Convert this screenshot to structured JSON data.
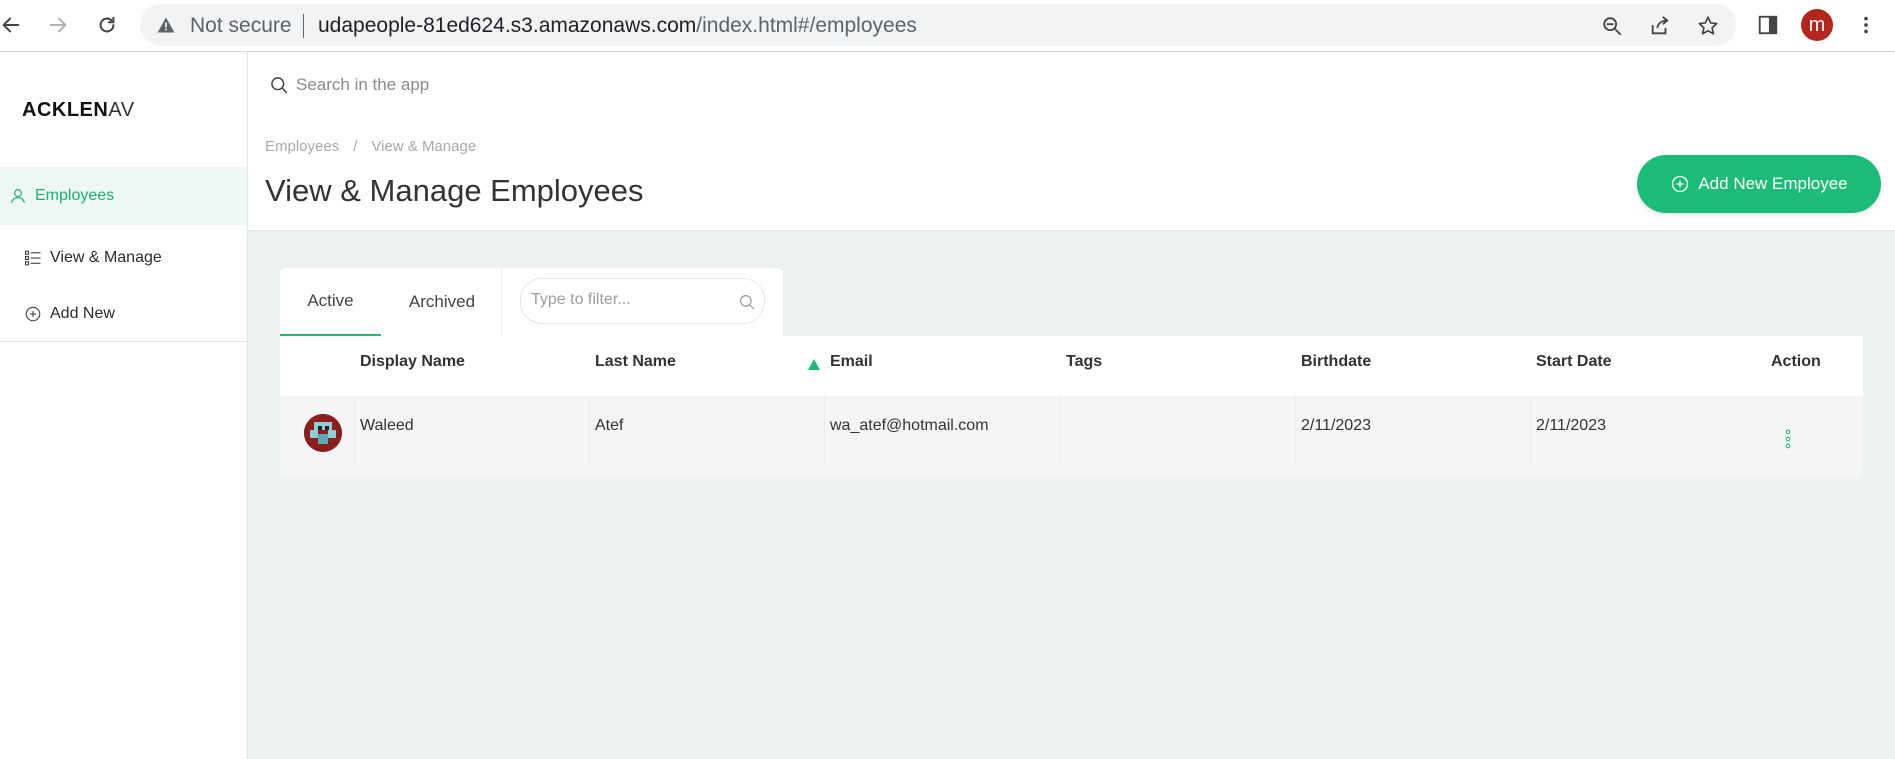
{
  "browser": {
    "security_label": "Not secure",
    "url_host": "udapeople-81ed624.s3.amazonaws.com",
    "url_path": "/index.html#/employees",
    "profile_initial": "m"
  },
  "app": {
    "logo_bold": "ACKLEN",
    "logo_light": "AV",
    "search_placeholder": "Search in the app"
  },
  "sidebar": {
    "items": [
      {
        "label": "Employees",
        "icon": "user-icon",
        "active": true
      },
      {
        "label": "View & Manage",
        "icon": "list-icon",
        "active": false
      },
      {
        "label": "Add New",
        "icon": "plus-circle-icon",
        "active": false
      }
    ]
  },
  "header": {
    "breadcrumb": [
      "Employees",
      "View & Manage"
    ],
    "breadcrumb_sep": "/",
    "title": "View & Manage Employees",
    "add_button_label": "Add New Employee"
  },
  "tabs": {
    "items": [
      {
        "label": "Active",
        "active": true
      },
      {
        "label": "Archived",
        "active": false
      }
    ],
    "filter_placeholder": "Type to filter..."
  },
  "table": {
    "columns": [
      "Display Name",
      "Last Name",
      "Email",
      "Tags",
      "Birthdate",
      "Start Date",
      "Action"
    ],
    "sorted_column": "Email",
    "rows": [
      {
        "display_name": "Waleed",
        "last_name": "Atef",
        "email": "wa_atef@hotmail.com",
        "tags": "",
        "birthdate": "2/11/2023",
        "start_date": "2/11/2023"
      }
    ]
  },
  "colors": {
    "accent": "#1dbb7a",
    "accent_text": "#1cae75",
    "content_bg": "#eef1f1",
    "profile": "#b3261e"
  }
}
